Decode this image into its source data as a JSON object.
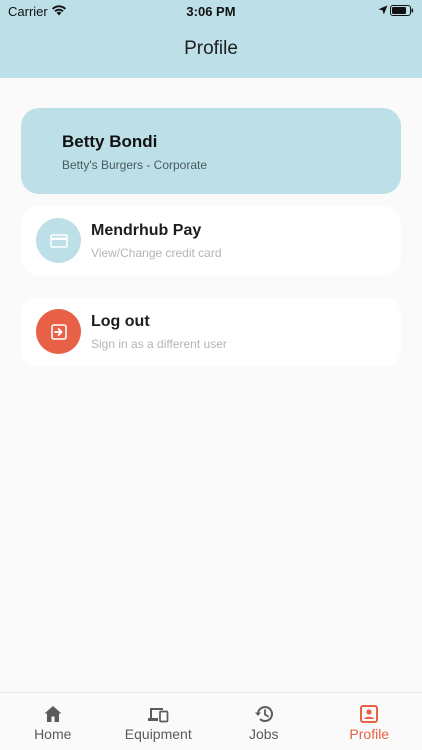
{
  "status_bar": {
    "carrier": "Carrier",
    "time": "3:06 PM"
  },
  "header": {
    "title": "Profile",
    "color": "#BDDFE8"
  },
  "profile": {
    "name": "Betty Bondi",
    "company": "Betty's Burgers - Corporate"
  },
  "menu": {
    "pay": {
      "title": "Mendrhub Pay",
      "subtitle": "View/Change credit card",
      "icon": "credit-card-icon"
    },
    "logout": {
      "title": "Log out",
      "subtitle": "Sign in as a different user",
      "icon": "logout-icon",
      "color": "#E86147"
    }
  },
  "tabs": [
    {
      "label": "Home",
      "icon": "home-icon",
      "active": false
    },
    {
      "label": "Equipment",
      "icon": "devices-icon",
      "active": false
    },
    {
      "label": "Jobs",
      "icon": "history-icon",
      "active": false
    },
    {
      "label": "Profile",
      "icon": "profile-icon",
      "active": true
    }
  ],
  "colors": {
    "accent": "#E86147",
    "brand_light": "#BDDFE8",
    "background": "#FAFAFA",
    "tab_inactive": "#5B5B5B"
  }
}
